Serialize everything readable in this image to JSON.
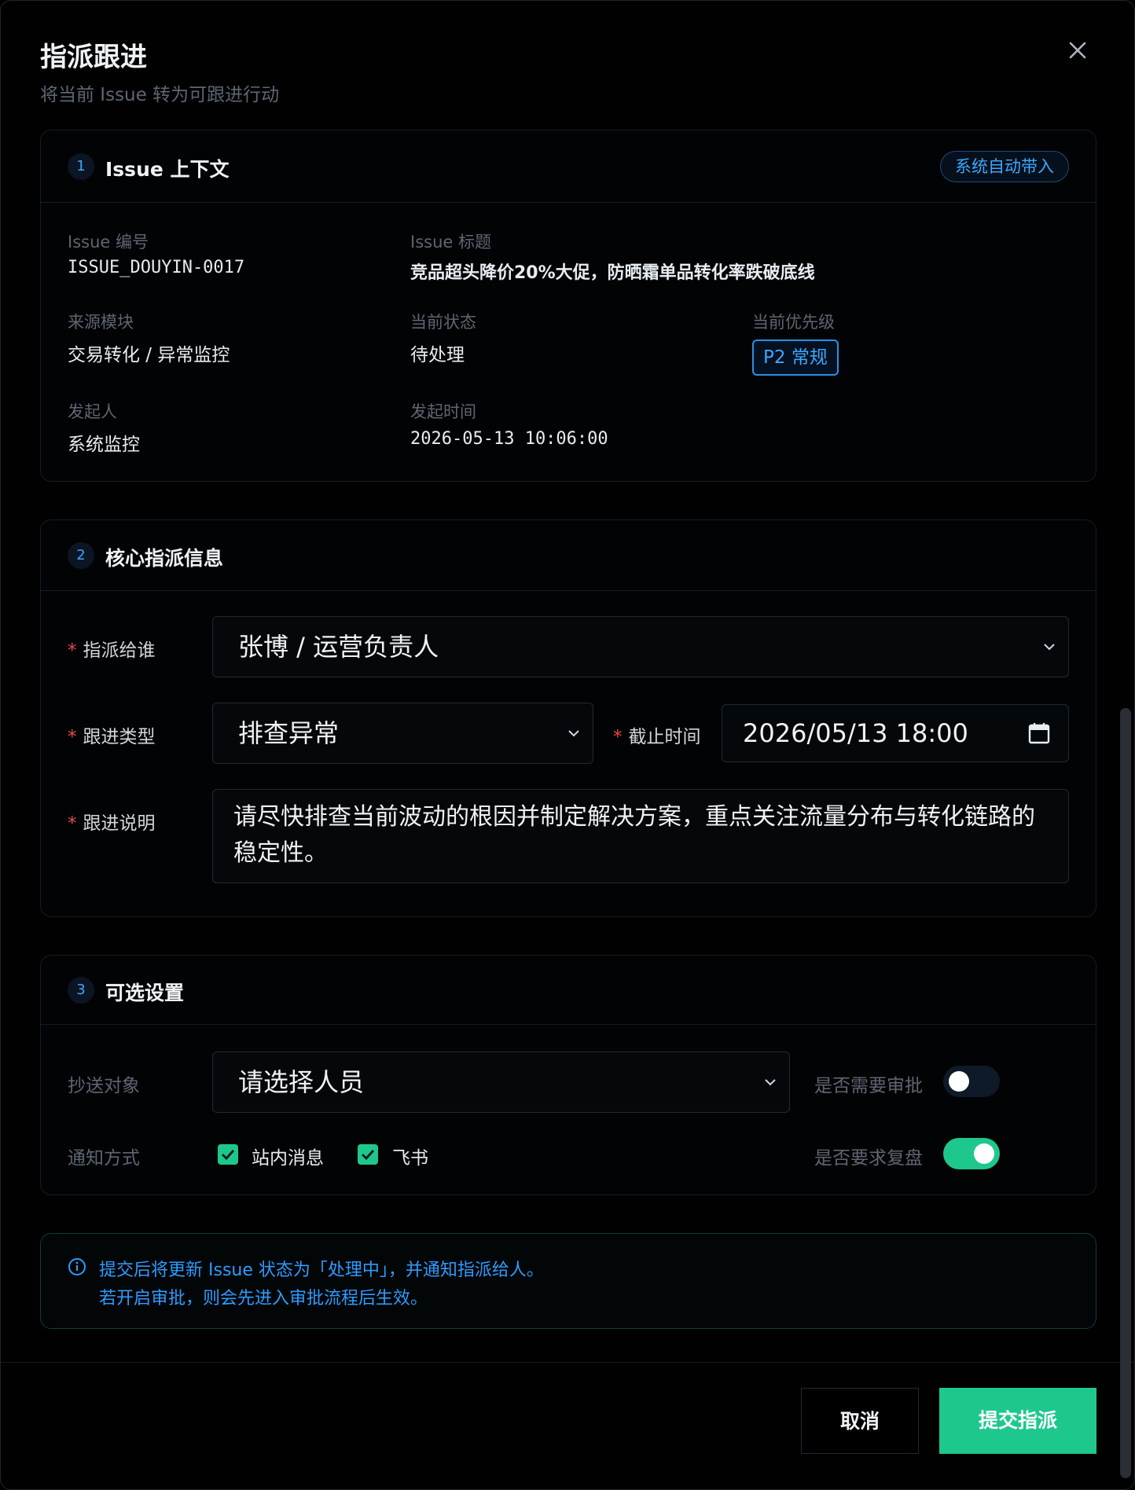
{
  "dialog": {
    "title": "指派跟进",
    "subtitle": "将当前 Issue 转为可跟进行动",
    "close_icon": "close-icon"
  },
  "context": {
    "step": "1",
    "title": "Issue 上下文",
    "auto_tag": "系统自动带入",
    "fields": {
      "id_label": "Issue 编号",
      "id_value": "ISSUE_DOUYIN-0017",
      "title_label": "Issue 标题",
      "title_value": "竞品超头降价20%大促，防晒霜单品转化率跌破底线",
      "source_label": "来源模块",
      "source_value": "交易转化 / 异常监控",
      "status_label": "当前状态",
      "status_value": "待处理",
      "priority_label": "当前优先级",
      "priority_value": "P2 常规",
      "initiator_label": "发起人",
      "initiator_value": "系统监控",
      "time_label": "发起时间",
      "time_value": "2026-05-13 10:06:00"
    }
  },
  "assign": {
    "step": "2",
    "title": "核心指派信息",
    "required_mark": "*",
    "assignee_label": "指派给谁",
    "assignee_value": "张博 / 运营负责人",
    "type_label": "跟进类型",
    "type_value": "排查异常",
    "deadline_label": "截止时间",
    "deadline_value": "2026/05/13 18:00",
    "desc_label": "跟进说明",
    "desc_value": "请尽快排查当前波动的根因并制定解决方案，重点关注流量分布与转化链路的稳定性。"
  },
  "optional": {
    "step": "3",
    "title": "可选设置",
    "cc_label": "抄送对象",
    "cc_placeholder": "请选择人员",
    "approval_label": "是否需要审批",
    "approval_on": false,
    "notify_label": "通知方式",
    "notify_options": [
      {
        "label": "站内消息",
        "checked": true
      },
      {
        "label": "飞书",
        "checked": true
      }
    ],
    "review_label": "是否要求复盘",
    "review_on": true
  },
  "notice": {
    "line1": "提交后将更新 Issue 状态为「处理中」，并通知指派给人。",
    "line2": "若开启审批，则会先进入审批流程后生效。"
  },
  "footer": {
    "cancel_label": "取消",
    "submit_label": "提交指派"
  },
  "colors": {
    "accent_blue": "#3ea6ff",
    "accent_green": "#1ec88d",
    "required_red": "#e5484d",
    "background": "#010101"
  }
}
